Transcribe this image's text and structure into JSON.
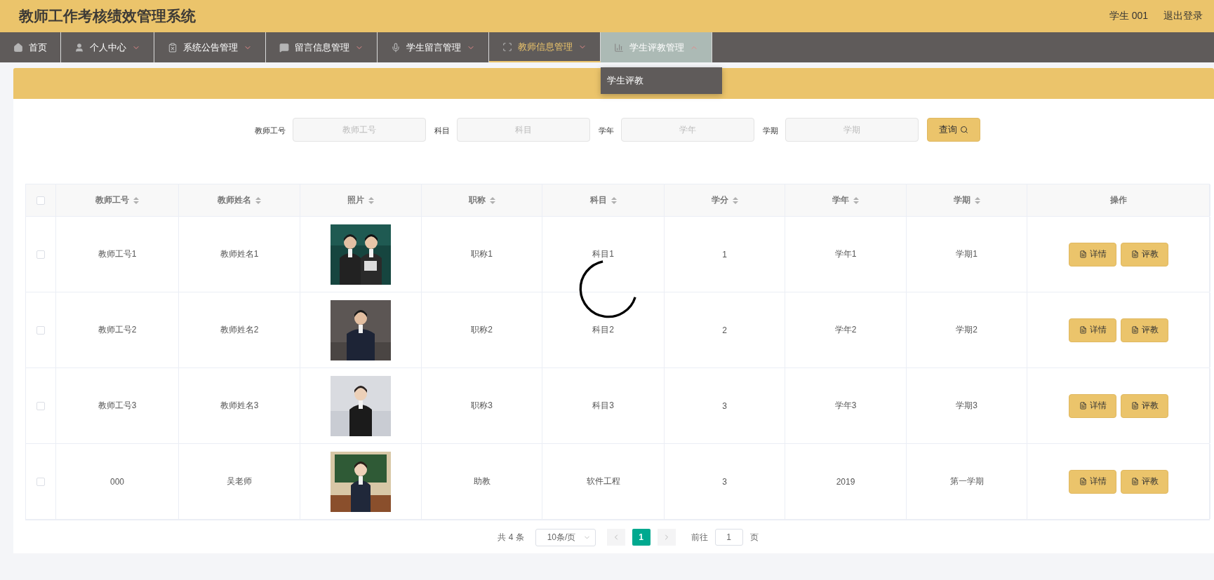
{
  "header": {
    "title": "教师工作考核绩效管理系统",
    "user": "学生 001",
    "logout": "退出登录"
  },
  "nav": [
    {
      "label": "首页",
      "selected": false,
      "expanded": false
    },
    {
      "label": "个人中心",
      "selected": false,
      "expanded": false
    },
    {
      "label": "系统公告管理",
      "selected": false,
      "expanded": false
    },
    {
      "label": "留言信息管理",
      "selected": false,
      "expanded": false
    },
    {
      "label": "学生留言管理",
      "selected": false,
      "expanded": false
    },
    {
      "label": "教师信息管理",
      "selected": true,
      "expanded": false
    },
    {
      "label": "学生评教管理",
      "selected": false,
      "expanded": true,
      "menu": [
        "学生评教"
      ]
    }
  ],
  "search": {
    "fields": [
      {
        "label": "教师工号",
        "placeholder": "教师工号"
      },
      {
        "label": "科目",
        "placeholder": "科目"
      },
      {
        "label": "学年",
        "placeholder": "学年"
      },
      {
        "label": "学期",
        "placeholder": "学期"
      }
    ],
    "button": "查询"
  },
  "table": {
    "select_all": {
      "checked": false
    },
    "columns": [
      "教师工号",
      "教师姓名",
      "照片",
      "职称",
      "科目",
      "学分",
      "学年",
      "学期",
      "操作"
    ],
    "rows": [
      {
        "checked": false,
        "cells": [
          "教师工号1",
          "教师姓名1",
          "",
          "职称1",
          "科目1",
          "1",
          "学年1",
          "学期1"
        ],
        "photo": {
          "kind": "picture"
        },
        "actions": [
          "详情",
          "评教"
        ]
      },
      {
        "checked": false,
        "cells": [
          "教师工号2",
          "教师姓名2",
          "",
          "职称2",
          "科目2",
          "2",
          "学年2",
          "学期2"
        ],
        "photo": {
          "kind": "picture"
        },
        "actions": [
          "详情",
          "评教"
        ]
      },
      {
        "checked": false,
        "cells": [
          "教师工号3",
          "教师姓名3",
          "",
          "职称3",
          "科目3",
          "3",
          "学年3",
          "学期3"
        ],
        "photo": {
          "kind": "picture"
        },
        "actions": [
          "详情",
          "评教"
        ]
      },
      {
        "checked": false,
        "cells": [
          "000",
          "吴老师",
          "",
          "助教",
          "软件工程",
          "3",
          "2019",
          "第一学期"
        ],
        "photo": {
          "kind": "picture"
        },
        "actions": [
          "详情",
          "评教"
        ]
      }
    ]
  },
  "pagination": {
    "total": "共 4 条",
    "page_size": "10条/页",
    "pages": [
      {
        "label": "1",
        "selected": true
      }
    ],
    "goto_label": "前往",
    "goto_value": "1",
    "goto_suffix": "页"
  },
  "loading": true
}
